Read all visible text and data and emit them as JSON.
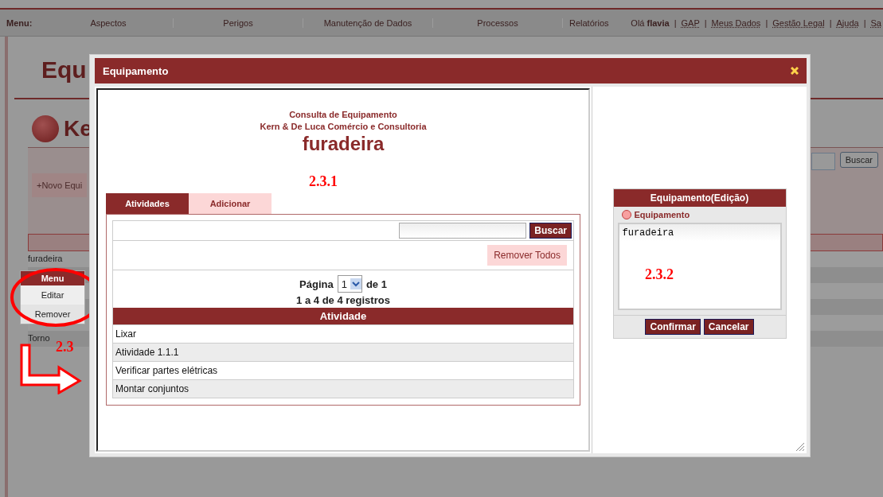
{
  "menu_bar": {
    "label": "Menu:",
    "items": [
      "Aspectos",
      "Perigos",
      "Manutenção de Dados",
      "Processos",
      "Relatórios"
    ],
    "user_links": [
      "Olá **flavia**",
      "GAP",
      "Meus Dados",
      "Gestão Legal",
      "Ajuda",
      "Sa"
    ],
    "separator": "|"
  },
  "page": {
    "title": "Equ",
    "section_title": "Ke",
    "new_button": "+Novo Equi",
    "search_button": "Buscar",
    "rows": [
      "furadeira",
      "Torno"
    ]
  },
  "context_menu": {
    "title": "Menu",
    "items": [
      "Editar",
      "Remover"
    ]
  },
  "modal": {
    "title": "Equipamento",
    "report": {
      "heading": "Consulta de Equipamento",
      "company": "Kern & De Luca Comércio e Consultoria",
      "name": "furadeira"
    },
    "tabs": [
      {
        "label": "Atividades",
        "selected": true
      },
      {
        "label": "Adicionar",
        "selected": false
      }
    ],
    "search_button": "Buscar",
    "remove_all_button": "Remover Todos",
    "pagination": {
      "page_label": "Página",
      "page": "1",
      "of_label": "de 1",
      "summary": "1 a 4 de 4 registros"
    },
    "table": {
      "columns": [
        "Atividade"
      ],
      "rows": [
        "Lixar",
        "Atividade 1.1.1",
        "Verificar partes elétricas",
        "Montar conjuntos"
      ]
    },
    "edit_panel": {
      "title": "Equipamento(Edição)",
      "field_label": "Equipamento",
      "value": "furadeira",
      "buttons": [
        "Confirmar",
        "Cancelar"
      ]
    }
  },
  "annotations": [
    {
      "label": "2.3"
    },
    {
      "label": "2.3.1"
    },
    {
      "label": "2.3.2"
    }
  ]
}
